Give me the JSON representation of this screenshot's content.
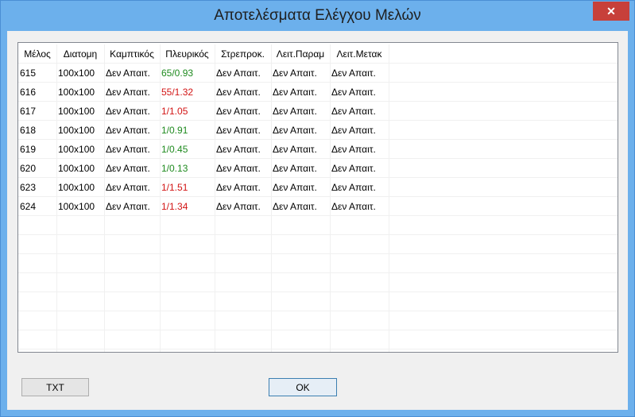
{
  "window": {
    "title": "Αποτελέσματα Ελέγχου Μελών",
    "close_glyph": "✕"
  },
  "table": {
    "columns": [
      "Μέλος",
      "Διατομη",
      "Καμπτικός",
      "Πλευρικός",
      "Στρεπροκ.",
      "Λειτ.Παραμ",
      "Λειτ.Μετακ"
    ],
    "rows": [
      {
        "member": "615",
        "section": "100x100",
        "bending": "Δεν Απαιτ.",
        "lateral": "65/0.93",
        "lateral_status": "ok",
        "torsion": "Δεν Απαιτ.",
        "serv_param": "Δεν Απαιτ.",
        "serv_disp": "Δεν Απαιτ."
      },
      {
        "member": "616",
        "section": "100x100",
        "bending": "Δεν Απαιτ.",
        "lateral": "55/1.32",
        "lateral_status": "fail",
        "torsion": "Δεν Απαιτ.",
        "serv_param": "Δεν Απαιτ.",
        "serv_disp": "Δεν Απαιτ."
      },
      {
        "member": "617",
        "section": "100x100",
        "bending": "Δεν Απαιτ.",
        "lateral": "1/1.05",
        "lateral_status": "fail",
        "torsion": "Δεν Απαιτ.",
        "serv_param": "Δεν Απαιτ.",
        "serv_disp": "Δεν Απαιτ."
      },
      {
        "member": "618",
        "section": "100x100",
        "bending": "Δεν Απαιτ.",
        "lateral": "1/0.91",
        "lateral_status": "ok",
        "torsion": "Δεν Απαιτ.",
        "serv_param": "Δεν Απαιτ.",
        "serv_disp": "Δεν Απαιτ."
      },
      {
        "member": "619",
        "section": "100x100",
        "bending": "Δεν Απαιτ.",
        "lateral": "1/0.45",
        "lateral_status": "ok",
        "torsion": "Δεν Απαιτ.",
        "serv_param": "Δεν Απαιτ.",
        "serv_disp": "Δεν Απαιτ."
      },
      {
        "member": "620",
        "section": "100x100",
        "bending": "Δεν Απαιτ.",
        "lateral": "1/0.13",
        "lateral_status": "ok",
        "torsion": "Δεν Απαιτ.",
        "serv_param": "Δεν Απαιτ.",
        "serv_disp": "Δεν Απαιτ."
      },
      {
        "member": "623",
        "section": "100x100",
        "bending": "Δεν Απαιτ.",
        "lateral": "1/1.51",
        "lateral_status": "fail",
        "torsion": "Δεν Απαιτ.",
        "serv_param": "Δεν Απαιτ.",
        "serv_disp": "Δεν Απαιτ."
      },
      {
        "member": "624",
        "section": "100x100",
        "bending": "Δεν Απαιτ.",
        "lateral": "1/1.34",
        "lateral_status": "fail",
        "torsion": "Δεν Απαιτ.",
        "serv_param": "Δεν Απαιτ.",
        "serv_disp": "Δεν Απαιτ."
      }
    ]
  },
  "buttons": {
    "txt": "TXT",
    "ok": "OK"
  },
  "colors": {
    "ok_text": "#1e8a1e",
    "fail_text": "#d21414",
    "title_bar": "#6cb0ec",
    "close_button": "#c7403a"
  }
}
